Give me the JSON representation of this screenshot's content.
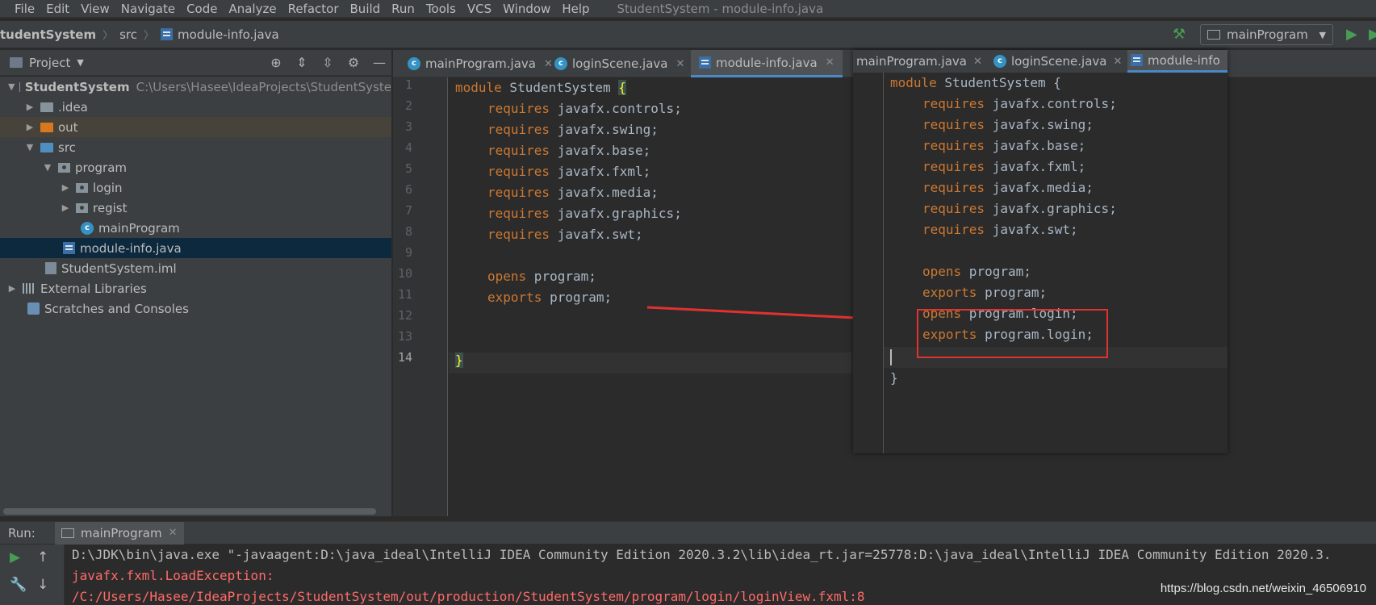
{
  "menu": {
    "items": [
      "File",
      "Edit",
      "View",
      "Navigate",
      "Code",
      "Analyze",
      "Refactor",
      "Build",
      "Run",
      "Tools",
      "VCS",
      "Window",
      "Help"
    ],
    "window_title": "StudentSystem - module-info.java"
  },
  "navbar": {
    "crumbs": [
      "tudentSystem",
      "src",
      "module-info.java"
    ],
    "run_config": "mainProgram"
  },
  "project": {
    "header_label": "Project",
    "tree": [
      {
        "label": "StudentSystem",
        "hint": "C:\\Users\\Hasee\\IdeaProjects\\StudentSyste"
      },
      {
        "label": ".idea"
      },
      {
        "label": "out"
      },
      {
        "label": "src"
      },
      {
        "label": "program"
      },
      {
        "label": "login"
      },
      {
        "label": "regist"
      },
      {
        "label": "mainProgram"
      },
      {
        "label": "module-info.java"
      },
      {
        "label": "StudentSystem.iml"
      },
      {
        "label": "External Libraries"
      },
      {
        "label": "Scratches and Consoles"
      }
    ]
  },
  "editor": {
    "tabs": [
      "mainProgram.java",
      "loginScene.java",
      "module-info.java"
    ],
    "line_numbers": [
      "1",
      "2",
      "3",
      "4",
      "5",
      "6",
      "7",
      "8",
      "9",
      "10",
      "11",
      "12",
      "13",
      "14"
    ],
    "lines": [
      {
        "kw": "module",
        "rest": " StudentSystem "
      },
      {
        "kw": "requires",
        "rest": " javafx.controls;"
      },
      {
        "kw": "requires",
        "rest": " javafx.swing;"
      },
      {
        "kw": "requires",
        "rest": " javafx.base;"
      },
      {
        "kw": "requires",
        "rest": " javafx.fxml;"
      },
      {
        "kw": "requires",
        "rest": " javafx.media;"
      },
      {
        "kw": "requires",
        "rest": " javafx.graphics;"
      },
      {
        "kw": "requires",
        "rest": " javafx.swt;"
      },
      {
        "kw": "",
        "rest": ""
      },
      {
        "kw": "opens",
        "rest": " program;"
      },
      {
        "kw": "exports",
        "rest": " program;"
      },
      {
        "kw": "",
        "rest": ""
      },
      {
        "kw": "",
        "rest": ""
      },
      {
        "kw": "",
        "rest": "}"
      }
    ],
    "open_brace": "{"
  },
  "overlay": {
    "tabs": [
      "mainProgram.java",
      "loginScene.java",
      "module-info"
    ],
    "lines": [
      {
        "kw": "module",
        "rest": " StudentSystem {"
      },
      {
        "kw": "requires",
        "rest": " javafx.controls;"
      },
      {
        "kw": "requires",
        "rest": " javafx.swing;"
      },
      {
        "kw": "requires",
        "rest": " javafx.base;"
      },
      {
        "kw": "requires",
        "rest": " javafx.fxml;"
      },
      {
        "kw": "requires",
        "rest": " javafx.media;"
      },
      {
        "kw": "requires",
        "rest": " javafx.graphics;"
      },
      {
        "kw": "requires",
        "rest": " javafx.swt;"
      },
      {
        "kw": "",
        "rest": ""
      },
      {
        "kw": "opens",
        "rest": " program;"
      },
      {
        "kw": "exports",
        "rest": " program;"
      },
      {
        "kw": "opens",
        "rest": " program.login;"
      },
      {
        "kw": "exports",
        "rest": " program.login;"
      },
      {
        "kw": "",
        "rest": ""
      },
      {
        "kw": "",
        "rest": "}"
      }
    ]
  },
  "run": {
    "label": "Run:",
    "tab": "mainProgram",
    "console": [
      "D:\\JDK\\bin\\java.exe \"-javaagent:D:\\java_ideal\\IntelliJ IDEA Community Edition 2020.3.2\\lib\\idea_rt.jar=25778:D:\\java_ideal\\IntelliJ IDEA Community Edition 2020.3.",
      "javafx.fxml.LoadException:",
      "/C:/Users/Hasee/IdeaProjects/StudentSystem/out/production/StudentSystem/program/login/loginView.fxml:8"
    ]
  },
  "watermark": "https://blog.csdn.net/weixin_46506910",
  "colors": {
    "keyword": "#cc7832",
    "text": "#a9b7c6",
    "error": "#ff6b68",
    "annotation": "#e0322f",
    "accent": "#4a88c7"
  }
}
